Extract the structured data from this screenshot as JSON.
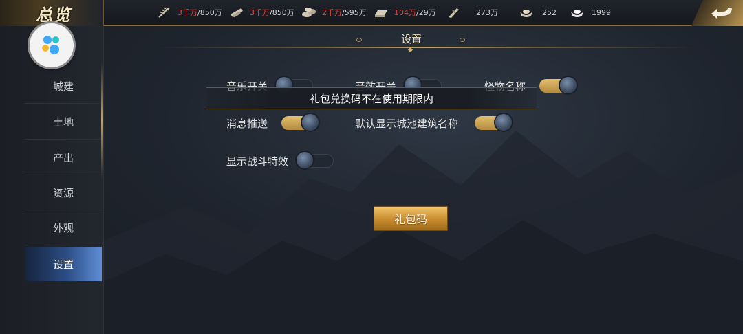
{
  "header": {
    "title": "总览",
    "resources": [
      {
        "icon": "grain-icon",
        "current": "3千万",
        "max": "/850万"
      },
      {
        "icon": "wood-icon",
        "current": "3千万",
        "max": "/850万"
      },
      {
        "icon": "stone-icon",
        "current": "2千万",
        "max": "/595万"
      },
      {
        "icon": "iron-icon",
        "current": "104万",
        "max": "/29万"
      },
      {
        "icon": "copper-coin-icon",
        "value": "273万"
      },
      {
        "icon": "gold-ingot-icon",
        "value": "252"
      },
      {
        "icon": "silver-ingot-icon",
        "value": "1999"
      }
    ],
    "back_icon": "back-arrow-icon"
  },
  "sidebar": {
    "avatar_icon": "app-logo-icon",
    "items": [
      {
        "label": "城建"
      },
      {
        "label": "土地"
      },
      {
        "label": "产出"
      },
      {
        "label": "资源"
      },
      {
        "label": "外观"
      },
      {
        "label": "设置",
        "active": true
      }
    ]
  },
  "settings": {
    "title": "设置",
    "toggles": {
      "music": {
        "label": "音乐开关",
        "on": false
      },
      "sound": {
        "label": "音效开关",
        "on": false
      },
      "monster_name": {
        "label": "怪物名称",
        "on": true
      },
      "push": {
        "label": "消息推送",
        "on": true
      },
      "building_name": {
        "label": "默认显示城池建筑名称",
        "on": true
      },
      "battle_effect": {
        "label": "显示战斗特效",
        "on": false
      }
    },
    "gift_code_button": "礼包码"
  },
  "toast": {
    "message": "礼包兑换码不在使用期限内"
  },
  "colors": {
    "accent_gold": "#d8b46a",
    "active_tab": "#2c4e86",
    "resource_over": "#e0463a"
  }
}
